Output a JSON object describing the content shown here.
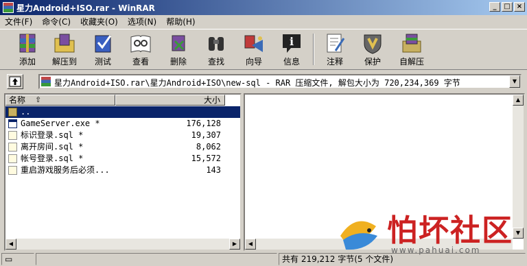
{
  "window": {
    "title": "星力Android+ISO.rar - WinRAR",
    "min": "_",
    "max": "□",
    "close": "×"
  },
  "menu": [
    "文件(F)",
    "命令(C)",
    "收藏夹(O)",
    "选项(N)",
    "帮助(H)"
  ],
  "toolbar": [
    {
      "label": "添加",
      "icon": "add-archive-icon"
    },
    {
      "label": "解压到",
      "icon": "extract-to-icon"
    },
    {
      "label": "测试",
      "icon": "test-icon"
    },
    {
      "label": "查看",
      "icon": "view-icon"
    },
    {
      "label": "删除",
      "icon": "delete-icon"
    },
    {
      "label": "查找",
      "icon": "find-icon"
    },
    {
      "label": "向导",
      "icon": "wizard-icon"
    },
    {
      "label": "信息",
      "icon": "info-icon"
    },
    {
      "label": "注释",
      "icon": "comment-icon"
    },
    {
      "label": "保护",
      "icon": "protect-icon"
    },
    {
      "label": "自解压",
      "icon": "sfx-icon"
    }
  ],
  "address": {
    "text": "星力Android+ISO.rar\\星力Android+ISO\\new-sql - RAR 压缩文件, 解包大小为 720,234,369 字节"
  },
  "columns": {
    "name": "名称",
    "size": "大小"
  },
  "files": [
    {
      "name": "..",
      "size": "",
      "type": "folder",
      "selected": true
    },
    {
      "name": "GameServer.exe *",
      "size": "176,128",
      "type": "exe"
    },
    {
      "name": "标识登录.sql *",
      "size": "19,307",
      "type": "sql"
    },
    {
      "name": "离开房间.sql *",
      "size": "8,062",
      "type": "sql"
    },
    {
      "name": "帐号登录.sql *",
      "size": "15,572",
      "type": "sql"
    },
    {
      "name": "重启游戏服务后必须...",
      "size": "143",
      "type": "sql"
    }
  ],
  "status": {
    "summary": "共有 219,212 字节(5 个文件)"
  },
  "watermark": {
    "text": "怕坏社区",
    "url": "www.pahuai.com"
  },
  "colors": {
    "title_dark": "#0a246a",
    "title_light": "#a6caf0",
    "face": "#d4d0c8",
    "watermark": "#cc2222"
  }
}
